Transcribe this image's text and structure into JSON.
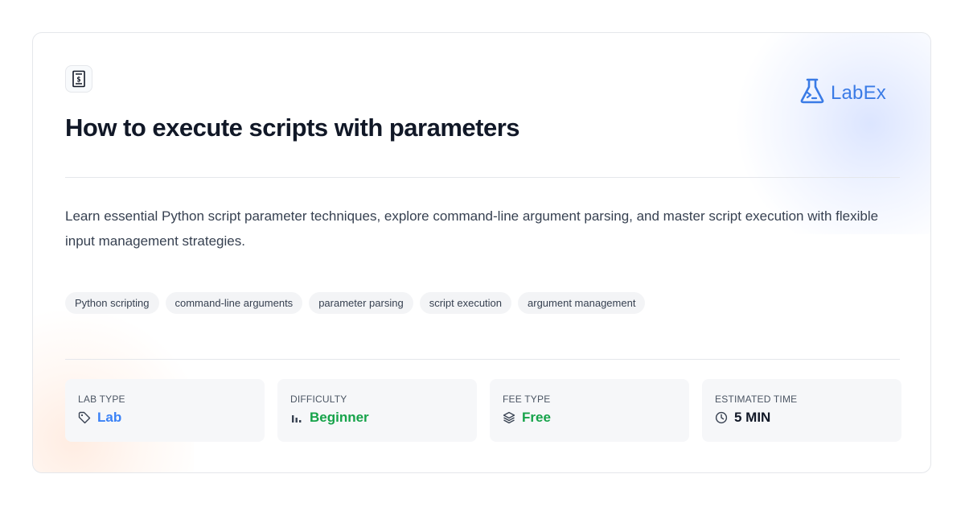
{
  "header": {
    "course_icon": "code-document-icon",
    "title": "How to execute scripts with parameters",
    "brand": "LabEx",
    "brand_icon": "flask-terminal-icon"
  },
  "description": "Learn essential Python script parameter techniques, explore command-line argument parsing, and master script execution with flexible input management strategies.",
  "tags": [
    "Python scripting",
    "command-line arguments",
    "parameter parsing",
    "script execution",
    "argument management"
  ],
  "stats": [
    {
      "label": "LAB TYPE",
      "value": "Lab",
      "icon": "tag-icon",
      "color": "#3b82f6"
    },
    {
      "label": "DIFFICULTY",
      "value": "Beginner",
      "icon": "bar-chart-icon",
      "color": "#16a34a"
    },
    {
      "label": "FEE TYPE",
      "value": "Free",
      "icon": "layers-icon",
      "color": "#16a34a"
    },
    {
      "label": "ESTIMATED TIME",
      "value": "5 MIN",
      "icon": "clock-icon",
      "color": "#111827"
    }
  ],
  "colors": {
    "brand": "#3a7be6",
    "title": "#111827",
    "text": "#374151"
  }
}
